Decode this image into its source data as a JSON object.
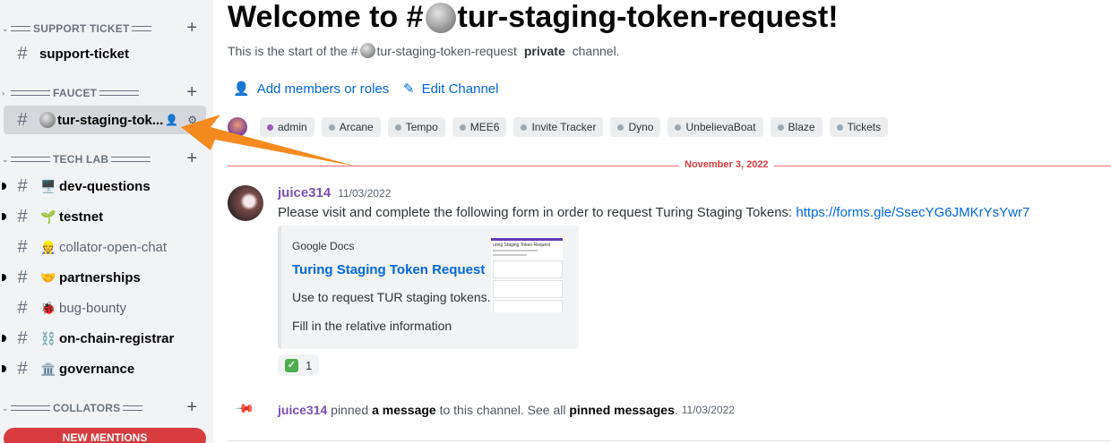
{
  "sidebar": {
    "categories": [
      {
        "label": "SUPPORT TICKET",
        "plus": "+"
      },
      {
        "label": "FAUCET",
        "plus": "+"
      },
      {
        "label": "TECH LAB",
        "plus": "+"
      },
      {
        "label": "COLLATORS",
        "plus": "+"
      }
    ],
    "channels": [
      {
        "name": "support-ticket",
        "emoji": ""
      },
      {
        "name": "tur-staging-tok...",
        "emoji": "coin"
      },
      {
        "name": "dev-questions",
        "emoji": "🖥️"
      },
      {
        "name": "testnet",
        "emoji": "🌱"
      },
      {
        "name": "collator-open-chat",
        "emoji": "👷"
      },
      {
        "name": "partnerships",
        "emoji": "🤝"
      },
      {
        "name": "bug-bounty",
        "emoji": "🐞"
      },
      {
        "name": "on-chain-registrar",
        "emoji": "⛓️"
      },
      {
        "name": "governance",
        "emoji": "🏛️"
      }
    ],
    "new_mentions": "NEW MENTIONS"
  },
  "header": {
    "title_prefix": "Welcome to #",
    "title_name": "tur-staging-token-request!",
    "subtitle_start": "This is the start of the #",
    "subtitle_name": "tur-staging-token-request",
    "subtitle_bold": "private",
    "subtitle_end": "channel."
  },
  "actions": {
    "add_members": "Add members or roles",
    "edit_channel": "Edit Channel"
  },
  "roles": [
    "admin",
    "Arcane",
    "Tempo",
    "MEE6",
    "Invite Tracker",
    "Dyno",
    "UnbelievaBoat",
    "Blaze",
    "Tickets"
  ],
  "divider": {
    "date": "November 3, 2022"
  },
  "message": {
    "author": "juice314",
    "timestamp": "11/03/2022",
    "text": "Please visit and complete the following form in order to request Turing Staging Tokens:",
    "link": "https://forms.gle/SsecYG6JMKrYsYwr7",
    "embed": {
      "provider": "Google Docs",
      "title": "Turing Staging Token Request",
      "desc1": "Use to request TUR staging tokens.",
      "desc2": "Fill in the relative information",
      "thumb_title": "uring Staging Token Request"
    },
    "reaction": {
      "emoji": "✅",
      "count": "1"
    }
  },
  "pinned": {
    "author": "juice314",
    "t1": "pinned",
    "b1": "a message",
    "t2": "to this channel. See all",
    "b2": "pinned messages",
    "t3": ".",
    "timestamp": "11/03/2022"
  },
  "colors": {
    "accent_link": "#0068e0",
    "author": "#7b4fb8",
    "divider": "#f23f42",
    "arrow": "#f58a1f"
  }
}
